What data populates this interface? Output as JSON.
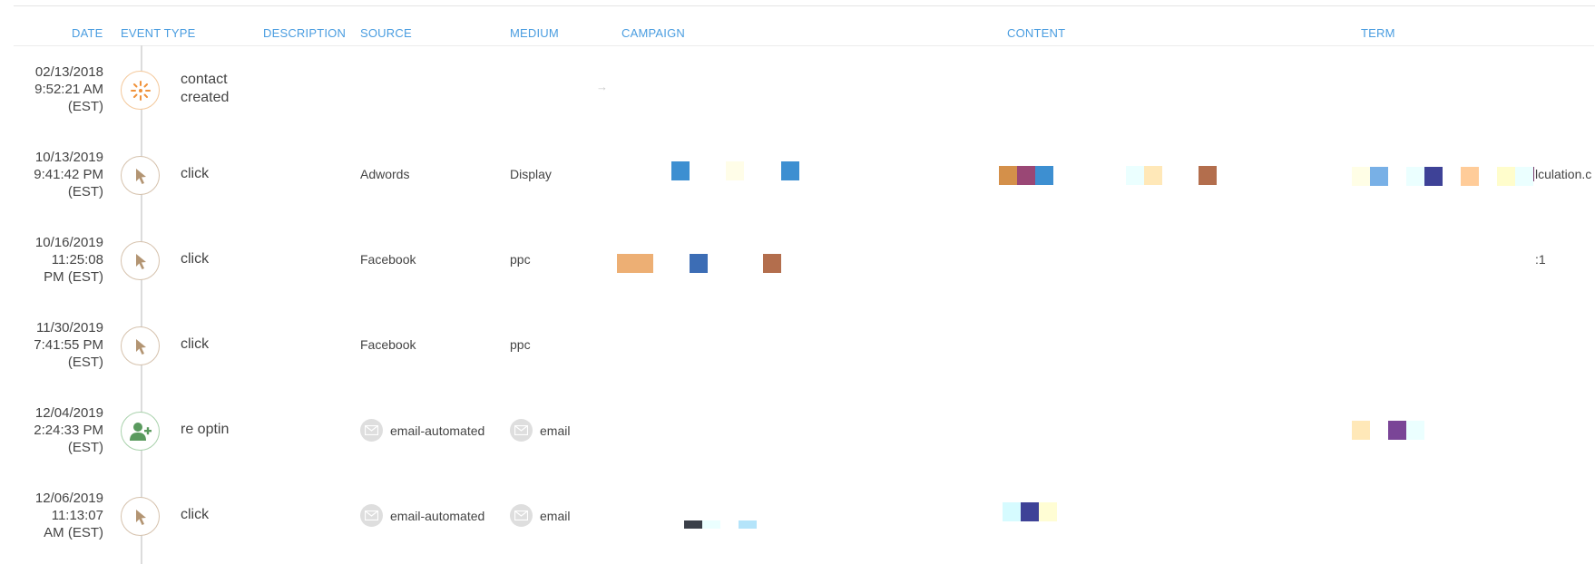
{
  "columns": {
    "date": "DATE",
    "event_type": "EVENT TYPE",
    "description": "DESCRIPTION",
    "source": "SOURCE",
    "medium": "MEDIUM",
    "campaign": "CAMPAIGN",
    "content": "CONTENT",
    "term": "TERM"
  },
  "colors": {
    "header_text": "#4a9de0",
    "created_icon": "#f0923a",
    "click_icon": "#b39573",
    "optin_icon": "#5a9a5e",
    "mail_badge": "#dedede"
  },
  "rows": [
    {
      "date": "02/13/2018",
      "time": "9:52:21 AM",
      "tz": "(EST)",
      "event_icon": "sparkle-icon",
      "event_line1": "contact",
      "event_line2": "created",
      "source": "",
      "medium": "",
      "campaign_arrow": "→"
    },
    {
      "date": "10/13/2019",
      "time": "9:41:42 PM",
      "tz": "(EST)",
      "event_icon": "cursor-icon",
      "event_line1": "click",
      "source": "Adwords",
      "medium": "Display",
      "term_tail": "lculation.c"
    },
    {
      "date": "10/16/2019",
      "time": "11:25:08",
      "tz": "PM (EST)",
      "event_icon": "cursor-icon",
      "event_line1": "click",
      "source": "Facebook",
      "medium": "ppc",
      "term_tail": "‌:1"
    },
    {
      "date": "11/30/2019",
      "time": "7:41:55 PM",
      "tz": "(EST)",
      "event_icon": "cursor-icon",
      "event_line1": "click",
      "source": "Facebook",
      "medium": "ppc"
    },
    {
      "date": "12/04/2019",
      "time": "2:24:33 PM",
      "tz": "(EST)",
      "event_icon": "add-user-icon",
      "event_line1": "re optin",
      "source": "email-automated",
      "source_icon": "mail-icon",
      "medium": "email",
      "medium_icon": "mail-icon"
    },
    {
      "date": "12/06/2019",
      "time": "11:13:07",
      "tz": "AM (EST)",
      "event_icon": "cursor-icon",
      "event_line1": "click",
      "source": "email-automated",
      "source_icon": "mail-icon",
      "medium": "email",
      "medium_icon": "mail-icon"
    }
  ]
}
